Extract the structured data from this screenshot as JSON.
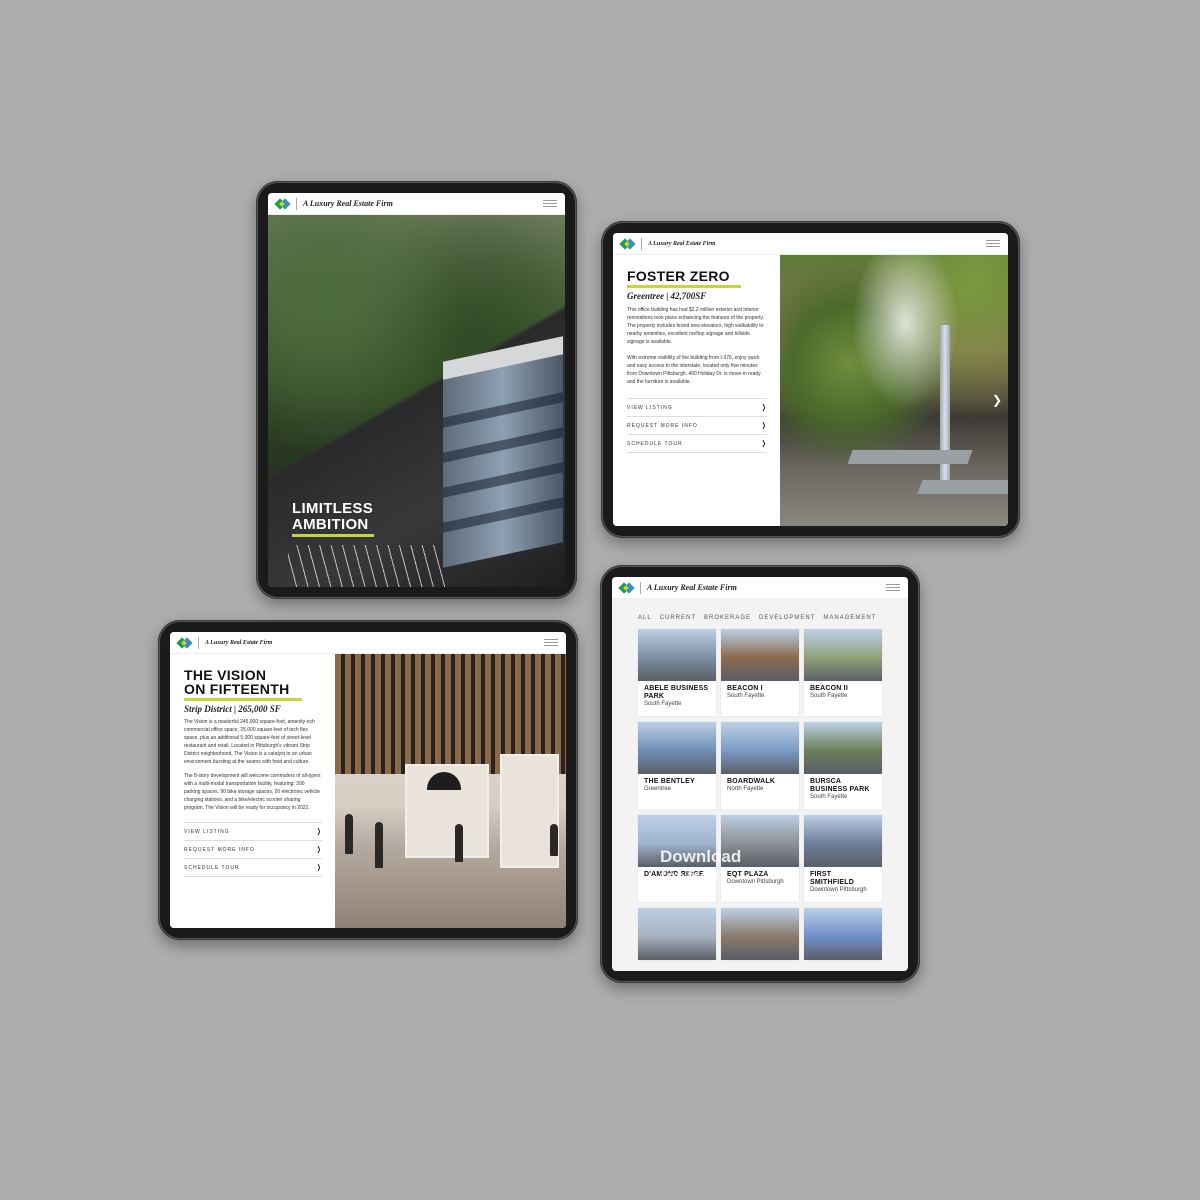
{
  "brand": {
    "tagline": "A Luxury Real Estate Firm",
    "colors": {
      "accent": "#c6d63a",
      "green": "#1f9e4a",
      "blue": "#2a7fb8"
    }
  },
  "tablet1": {
    "hero": [
      "LIMITLESS",
      "AMBITION"
    ]
  },
  "tablet2": {
    "title": "FOSTER ZERO",
    "subtitle": "Greentree | 42,700SF",
    "paragraphs": [
      "This office building has had $2.2 million exterior and interior renovations took place enhancing the features of the property. The property includes brand new elevators, high walkability to nearby amenities, excellent rooftop signage and hillside signage is available.",
      "With extreme visibility of the building from I-376, enjoy quick and easy access to the interstate, located only five minutes from Downtown Pittsburgh. 400 Holiday Dr. is move-in ready and the furniture is available."
    ],
    "links": [
      "VIEW LISTING",
      "REQUEST MORE INFO",
      "SCHEDULE TOUR"
    ]
  },
  "tablet3": {
    "title": [
      "THE VISION",
      "ON FIFTEENTH"
    ],
    "subtitle": "Strip District | 265,000 SF",
    "paragraphs": [
      "The Vision is a masterful 245,000 square-foot, amenity-rich commercial office space, 25,000 square-feet of tech flex space, plus an additional 5,000 square-feet of street-level restaurant and retail. Located in Pittsburgh's vibrant Strip District neighborhood, The Vision is a catalyst to an urban environment bursting at the seams with food and culture.",
      "The 8-story development will welcome commuters of all-types with a multi-modal transportation facility, featuring: 390 parking spaces, 90 bike storage spaces, 20 electronic vehicle charging stations, and a bike/electric scooter sharing program. The Vision will be ready for occupancy in 2022."
    ],
    "links": [
      "VIEW LISTING",
      "REQUEST MORE INFO",
      "SCHEDULE TOUR"
    ]
  },
  "tablet4": {
    "filters": [
      "ALL",
      "CURRENT",
      "BROKERAGE",
      "DEVELOPMENT",
      "MANAGEMENT"
    ],
    "properties": [
      {
        "name": "ABELE BUSINESS PARK",
        "location": "South Fayette",
        "color": "#7d8fa3"
      },
      {
        "name": "BEACON I",
        "location": "South Fayette",
        "color": "#8b6a4e"
      },
      {
        "name": "BEACON II",
        "location": "South Fayette",
        "color": "#90a27a"
      },
      {
        "name": "THE BENTLEY",
        "location": "Greentree",
        "color": "#6f8fb5"
      },
      {
        "name": "BOARDWALK",
        "location": "North Fayette",
        "color": "#7a9bc4"
      },
      {
        "name": "BURSCA BUSINESS PARK",
        "location": "South Fayette",
        "color": "#6b7f5a"
      },
      {
        "name": "D'AMOND RIDGE",
        "location": "",
        "color": "#9fb3cf"
      },
      {
        "name": "EQT PLAZA",
        "location": "Downtown Pittsburgh",
        "color": "#8c8f95"
      },
      {
        "name": "FIRST SMITHFIELD",
        "location": "Downtown Pittsburgh",
        "color": "#6d7d9a"
      },
      {
        "name": "",
        "location": "",
        "color": "#a7b2bf"
      },
      {
        "name": "",
        "location": "",
        "color": "#8a7a6a"
      },
      {
        "name": "",
        "location": "",
        "color": "#6f8fc8"
      }
    ],
    "watermark": [
      "Download",
      "",
      "for free"
    ]
  }
}
